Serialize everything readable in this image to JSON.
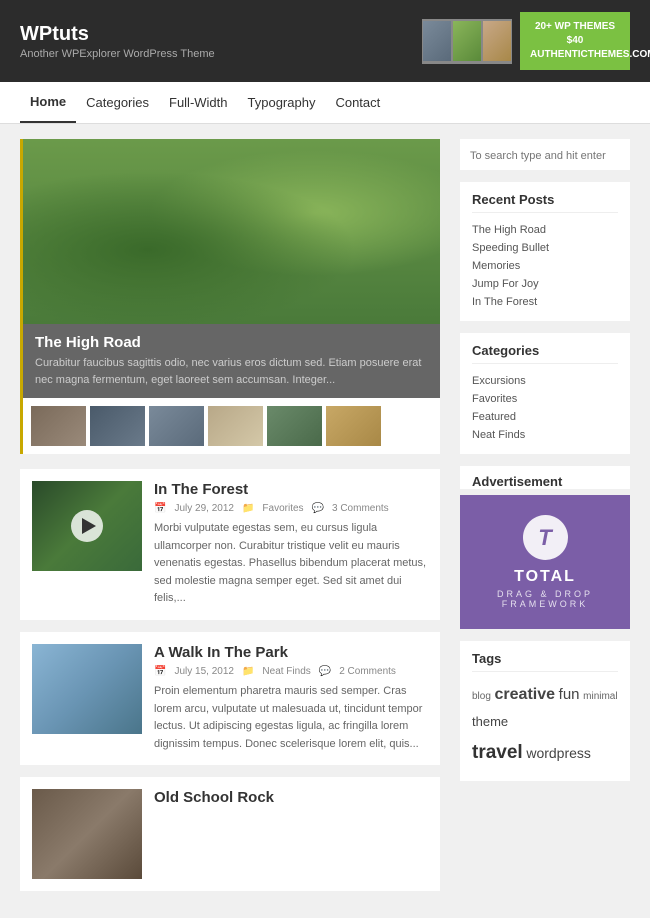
{
  "header": {
    "title": "WPtuts",
    "subtitle": "Another WPExplorer WordPress Theme",
    "ad_line1": "20+ WP THEMES $40",
    "ad_line2": "AUTHENTICTHEMES.COM"
  },
  "nav": {
    "items": [
      {
        "label": "Home",
        "active": true
      },
      {
        "label": "Categories",
        "active": false
      },
      {
        "label": "Full-Width",
        "active": false
      },
      {
        "label": "Typography",
        "active": false
      },
      {
        "label": "Contact",
        "active": false
      }
    ]
  },
  "featured_post": {
    "title": "The High Road",
    "excerpt": "Curabitur faucibus sagittis odio, nec varius eros dictum sed. Etiam posuere erat nec magna fermentum, eget laoreet sem accumsan. Integer..."
  },
  "posts": [
    {
      "title": "In The Forest",
      "date": "July 29, 2012",
      "category": "Favorites",
      "comments": "3 Comments",
      "has_video": true,
      "excerpt": "Morbi vulputate egestas sem, eu cursus ligula ullamcorper non. Curabitur tristique velit eu mauris venenatis egestas. Phasellus bibendum placerat metus, sed molestie magna semper eget. Sed sit amet dui felis,..."
    },
    {
      "title": "A Walk In The Park",
      "date": "July 15, 2012",
      "category": "Neat Finds",
      "comments": "2 Comments",
      "has_video": false,
      "excerpt": "Proin elementum pharetra mauris sed semper. Cras lorem arcu, vulputate ut malesuada ut, tincidunt tempor lectus. Ut adipiscing egestas ligula, ac fringilla lorem dignissim tempus. Donec scelerisque lorem elit, quis..."
    },
    {
      "title": "Old School Rock",
      "date": "",
      "category": "",
      "comments": "",
      "has_video": false,
      "excerpt": ""
    }
  ],
  "sidebar": {
    "search_placeholder": "To search type and hit enter",
    "recent_posts_title": "Recent Posts",
    "recent_posts": [
      "The High Road",
      "Speeding Bullet",
      "Memories",
      "Jump For Joy",
      "In The Forest"
    ],
    "categories_title": "Categories",
    "categories": [
      "Excursions",
      "Favorites",
      "Featured",
      "Neat Finds"
    ],
    "advertisement_title": "Advertisement",
    "ad_letter": "T",
    "ad_title": "TOTAL",
    "ad_subtitle": "DRAG & DROP\nFRAMEWORK",
    "tags_title": "Tags",
    "tags": [
      {
        "label": "blog",
        "size": "small"
      },
      {
        "label": "creative",
        "size": "large"
      },
      {
        "label": "fun",
        "size": "medium"
      },
      {
        "label": "minimal",
        "size": "small"
      },
      {
        "label": "theme",
        "size": "medium"
      },
      {
        "label": "travel",
        "size": "xlarge"
      },
      {
        "label": "wordpress",
        "size": "medium"
      }
    ]
  }
}
